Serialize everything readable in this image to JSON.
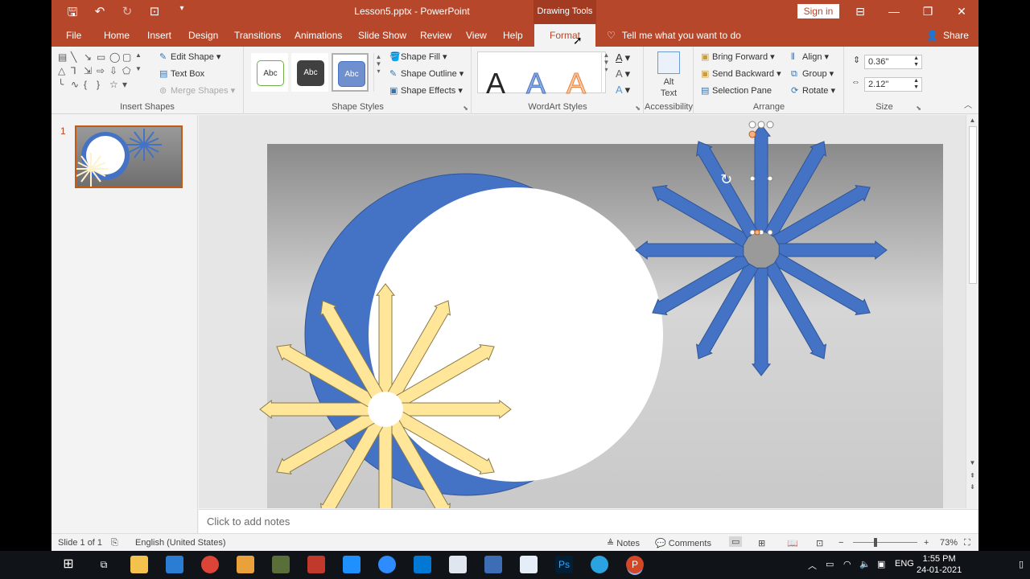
{
  "window": {
    "doc_title": "Lesson5.pptx  -  PowerPoint",
    "tools_tab": "Drawing Tools",
    "sign_in": "Sign in",
    "qat_icons": [
      "save-icon",
      "undo-icon",
      "redo-icon",
      "touch-mode-icon",
      "customize-icon"
    ]
  },
  "tabs": [
    "File",
    "Home",
    "Insert",
    "Design",
    "Transitions",
    "Animations",
    "Slide Show",
    "Review",
    "View",
    "Help",
    "Format"
  ],
  "tell_me": "Tell me what you want to do",
  "share": "Share",
  "ribbon": {
    "insert_shapes": {
      "label": "Insert Shapes",
      "edit_shape": "Edit Shape",
      "text_box": "Text Box",
      "merge_shapes": "Merge Shapes"
    },
    "shape_styles": {
      "label": "Shape Styles",
      "chip": "Abc",
      "fill": "Shape Fill",
      "outline": "Shape Outline",
      "effects": "Shape Effects"
    },
    "wordart": {
      "label": "WordArt Styles",
      "letter": "A"
    },
    "accessibility": {
      "label": "Accessibility",
      "alt": "Alt",
      "text": "Text"
    },
    "arrange": {
      "label": "Arrange",
      "bring_forward": "Bring Forward",
      "send_backward": "Send Backward",
      "selection_pane": "Selection Pane",
      "align": "Align",
      "group": "Group",
      "rotate": "Rotate"
    },
    "size": {
      "label": "Size",
      "height": "0.36\"",
      "width": "2.12\""
    }
  },
  "slide_panel": {
    "number": "1"
  },
  "notes_placeholder": "Click to add notes",
  "status": {
    "slide": "Slide 1 of 1",
    "language": "English (United States)",
    "notes": "Notes",
    "comments": "Comments",
    "zoom": "73%"
  },
  "taskbar": {
    "lang": "ENG",
    "time": "1:55 PM",
    "date": "24-01-2021"
  },
  "colors": {
    "accent": "#b7472a",
    "ring": "#4472c4",
    "burst": "#ffe699"
  }
}
